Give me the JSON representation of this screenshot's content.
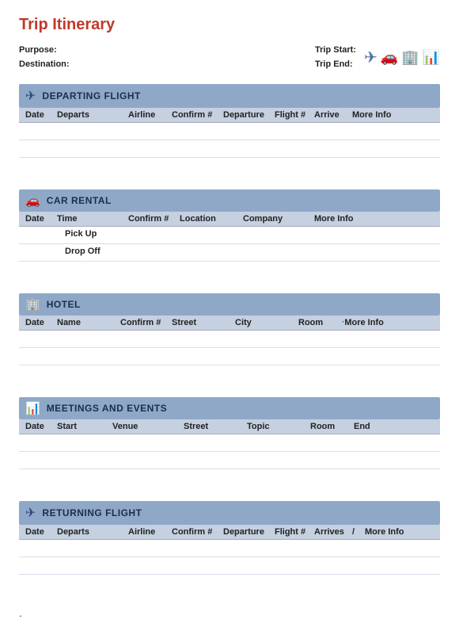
{
  "title": "Trip Itinerary",
  "meta": {
    "purpose_label": "Purpose:",
    "destination_label": "Destination:",
    "trip_start_label": "Trip Start:",
    "trip_end_label": "Trip End:"
  },
  "icons": {
    "plane": "✈",
    "car": "🚗",
    "building": "🏢",
    "chart": "📊"
  },
  "sections": {
    "departing": {
      "title": "DEPARTING FLIGHT",
      "columns": [
        "Date",
        "Departs",
        "Airline",
        "Confirm #",
        "Departure",
        "Flight #",
        "Arrive",
        "More Info"
      ]
    },
    "car_rental": {
      "title": "CAR RENTAL",
      "columns": [
        "Date",
        "Time",
        "Confirm #",
        "Location",
        "Company",
        "More Info"
      ],
      "subrows": [
        "Pick Up",
        "Drop Off"
      ]
    },
    "hotel": {
      "title": "HOTEL",
      "columns": [
        "Date",
        "Name",
        "Confirm #",
        "Street",
        "City",
        "Room",
        "More Info"
      ]
    },
    "meetings": {
      "title": "MEETINGS AND EVENTS",
      "columns": [
        "Date",
        "Start",
        "Venue",
        "Street",
        "Topic",
        "Room",
        "End"
      ]
    },
    "returning": {
      "title": "RETURNING FLIGHT",
      "columns": [
        "Date",
        "Departs",
        "Airline",
        "Confirm #",
        "Departure",
        "Flight #",
        "Arrives",
        "More Info"
      ]
    }
  }
}
